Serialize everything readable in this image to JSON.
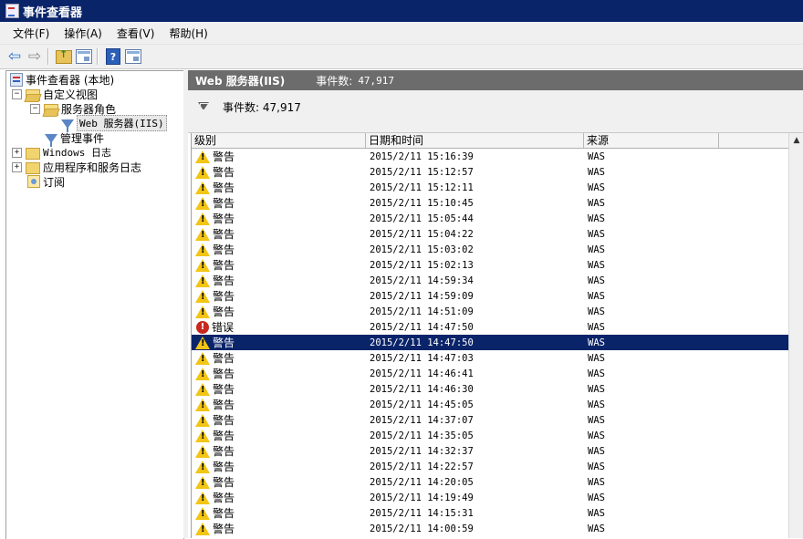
{
  "window": {
    "title": "事件查看器"
  },
  "menu": [
    {
      "label": "文件(F)"
    },
    {
      "label": "操作(A)"
    },
    {
      "label": "查看(V)"
    },
    {
      "label": "帮助(H)"
    }
  ],
  "toolbar": {
    "buttons": [
      "back-arrow-icon",
      "forward-arrow-icon",
      "folder-up-icon",
      "show-hide-tree-icon",
      "help-icon",
      "show-action-pane-icon"
    ],
    "help_glyph": "?"
  },
  "tree": {
    "root": "事件查看器 (本地)",
    "custom_views": "自定义视图",
    "server_roles": "服务器角色",
    "web_server": "Web 服务器(IIS)",
    "admin_events": "管理事件",
    "windows_logs": "Windows 日志",
    "app_service_logs": "应用程序和服务日志",
    "subscriptions": "订阅",
    "expanders": {
      "minus": "−",
      "plus": "+"
    }
  },
  "header": {
    "title": "Web 服务器(IIS)",
    "count_label": "事件数:",
    "count": "47,917"
  },
  "filter": {
    "text": "事件数: 47,917"
  },
  "grid": {
    "columns": [
      "级别",
      "日期和时间",
      "来源"
    ],
    "selected_index": 12,
    "rows": [
      {
        "level": "警告",
        "type": "warning",
        "datetime": "2015/2/11 15:16:39",
        "source": "WAS"
      },
      {
        "level": "警告",
        "type": "warning",
        "datetime": "2015/2/11 15:12:57",
        "source": "WAS"
      },
      {
        "level": "警告",
        "type": "warning",
        "datetime": "2015/2/11 15:12:11",
        "source": "WAS"
      },
      {
        "level": "警告",
        "type": "warning",
        "datetime": "2015/2/11 15:10:45",
        "source": "WAS"
      },
      {
        "level": "警告",
        "type": "warning",
        "datetime": "2015/2/11 15:05:44",
        "source": "WAS"
      },
      {
        "level": "警告",
        "type": "warning",
        "datetime": "2015/2/11 15:04:22",
        "source": "WAS"
      },
      {
        "level": "警告",
        "type": "warning",
        "datetime": "2015/2/11 15:03:02",
        "source": "WAS"
      },
      {
        "level": "警告",
        "type": "warning",
        "datetime": "2015/2/11 15:02:13",
        "source": "WAS"
      },
      {
        "level": "警告",
        "type": "warning",
        "datetime": "2015/2/11 14:59:34",
        "source": "WAS"
      },
      {
        "level": "警告",
        "type": "warning",
        "datetime": "2015/2/11 14:59:09",
        "source": "WAS"
      },
      {
        "level": "警告",
        "type": "warning",
        "datetime": "2015/2/11 14:51:09",
        "source": "WAS"
      },
      {
        "level": "错误",
        "type": "error",
        "datetime": "2015/2/11 14:47:50",
        "source": "WAS"
      },
      {
        "level": "警告",
        "type": "warning",
        "datetime": "2015/2/11 14:47:50",
        "source": "WAS"
      },
      {
        "level": "警告",
        "type": "warning",
        "datetime": "2015/2/11 14:47:03",
        "source": "WAS"
      },
      {
        "level": "警告",
        "type": "warning",
        "datetime": "2015/2/11 14:46:41",
        "source": "WAS"
      },
      {
        "level": "警告",
        "type": "warning",
        "datetime": "2015/2/11 14:46:30",
        "source": "WAS"
      },
      {
        "level": "警告",
        "type": "warning",
        "datetime": "2015/2/11 14:45:05",
        "source": "WAS"
      },
      {
        "level": "警告",
        "type": "warning",
        "datetime": "2015/2/11 14:37:07",
        "source": "WAS"
      },
      {
        "level": "警告",
        "type": "warning",
        "datetime": "2015/2/11 14:35:05",
        "source": "WAS"
      },
      {
        "level": "警告",
        "type": "warning",
        "datetime": "2015/2/11 14:32:37",
        "source": "WAS"
      },
      {
        "level": "警告",
        "type": "warning",
        "datetime": "2015/2/11 14:22:57",
        "source": "WAS"
      },
      {
        "level": "警告",
        "type": "warning",
        "datetime": "2015/2/11 14:20:05",
        "source": "WAS"
      },
      {
        "level": "警告",
        "type": "warning",
        "datetime": "2015/2/11 14:19:49",
        "source": "WAS"
      },
      {
        "level": "警告",
        "type": "warning",
        "datetime": "2015/2/11 14:15:31",
        "source": "WAS"
      },
      {
        "level": "警告",
        "type": "warning",
        "datetime": "2015/2/11 14:00:59",
        "source": "WAS"
      }
    ]
  },
  "scrollbar": {
    "up_glyph": "▲"
  },
  "colors": {
    "title_bar": "#0a246a",
    "header_bar": "#6c6c6c",
    "selection": "#0a246a",
    "warning": "#f3c515",
    "error": "#c8281e"
  }
}
